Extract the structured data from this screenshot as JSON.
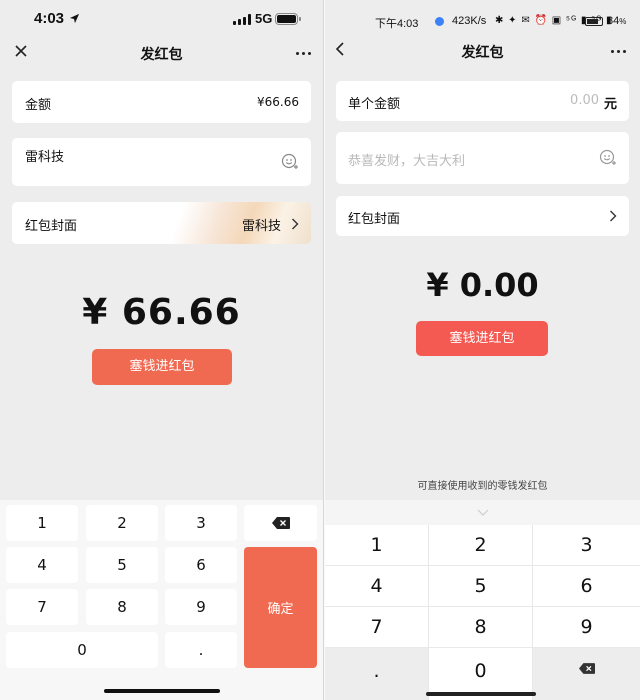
{
  "left": {
    "status": {
      "time": "4:03",
      "network": "5G"
    },
    "nav": {
      "title": "发红包"
    },
    "amount": {
      "label": "金额",
      "value": "¥66.66"
    },
    "message": {
      "value": "雷科技"
    },
    "cover": {
      "label": "红包封面",
      "value": "雷科技"
    },
    "total": "¥ 66.66",
    "submit_label": "塞钱进红包",
    "keypad": {
      "keys": [
        "1",
        "2",
        "3",
        "4",
        "5",
        "6",
        "7",
        "8",
        "9",
        "0",
        "."
      ],
      "confirm_label": "确定"
    }
  },
  "right": {
    "status": {
      "time": "下午4:03",
      "speed": "423K/s",
      "icons": "✱ ✦ ✉ ⏰ ▣ ⁵ᴳ ▮ ⁵ᴳ ▮",
      "battery": "84"
    },
    "nav": {
      "title": "发红包"
    },
    "amount": {
      "label": "单个金额",
      "placeholder": "0.00",
      "unit": "元"
    },
    "message": {
      "placeholder": "恭喜发财，大吉大利"
    },
    "cover": {
      "label": "红包封面"
    },
    "total": "¥ 0.00",
    "submit_label": "塞钱进红包",
    "hint": "可直接使用收到的零钱发红包",
    "keypad": {
      "keys": [
        "1",
        "2",
        "3",
        "4",
        "5",
        "6",
        "7",
        "8",
        "9",
        ".",
        "0"
      ]
    }
  },
  "colors": {
    "red_button": "#f45a52",
    "orange_button": "#f06a52",
    "confirm_key": "#f06a52"
  }
}
